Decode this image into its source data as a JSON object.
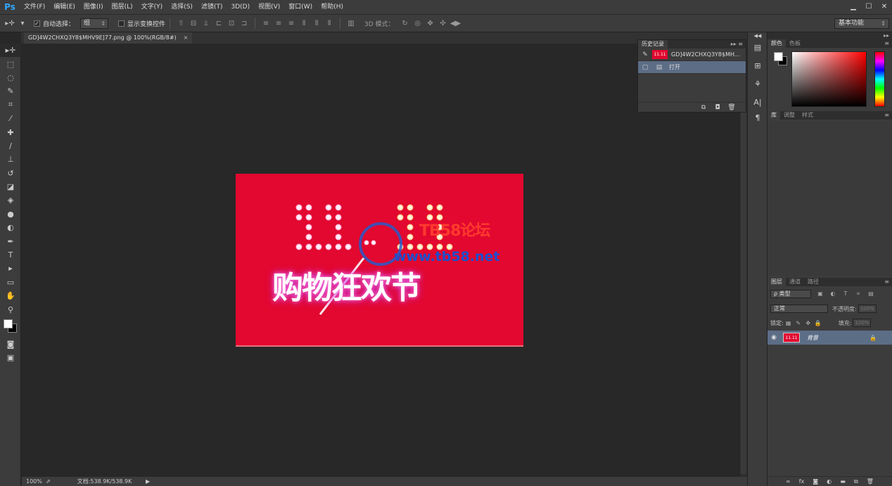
{
  "app": {
    "logo": "Ps"
  },
  "menu": [
    "文件(F)",
    "编辑(E)",
    "图像(I)",
    "图层(L)",
    "文字(Y)",
    "选择(S)",
    "滤镜(T)",
    "3D(D)",
    "视图(V)",
    "窗口(W)",
    "帮助(H)"
  ],
  "window": {
    "minimize": "▁",
    "maximize": "☐",
    "close": "✕"
  },
  "options": {
    "auto_select_label": "自动选择：",
    "auto_select_value": "组",
    "show_transform_label": "显示变换控件",
    "mode_3d_label": "3D 模式：",
    "workspace": "基本功能"
  },
  "document": {
    "tab_title": "GD]4W2CHXQ3Y8$MHV9E]77.png @ 100%(RGB/8#)",
    "close": "×",
    "artwork_title": "购物狂欢节",
    "watermark_cn": "TB58论坛",
    "watermark_url": "www.tb58.net"
  },
  "status": {
    "zoom": "100%",
    "doc_info": "文档:538.9K/538.9K",
    "arrow": "▶"
  },
  "history": {
    "tab": "历史记录",
    "snapshot_name": "GD]4W2CHXQ3Y8$MH...",
    "items": [
      {
        "label": "打开"
      }
    ],
    "thumb_text": "11.11"
  },
  "color_panel": {
    "tabs": [
      "颜色",
      "色板"
    ]
  },
  "library_panel": {
    "tabs": [
      "库",
      "调整",
      "样式"
    ]
  },
  "layers_panel": {
    "tabs": [
      "图层",
      "通道",
      "路径"
    ],
    "kind": "ρ 类型",
    "blend_mode": "正常",
    "opacity_label": "不透明度:",
    "opacity_value": "100%",
    "lock_label": "锁定:",
    "fill_label": "填充:",
    "fill_value": "100%",
    "layers": [
      {
        "name": "背景",
        "thumb_text": "11.11"
      }
    ]
  }
}
